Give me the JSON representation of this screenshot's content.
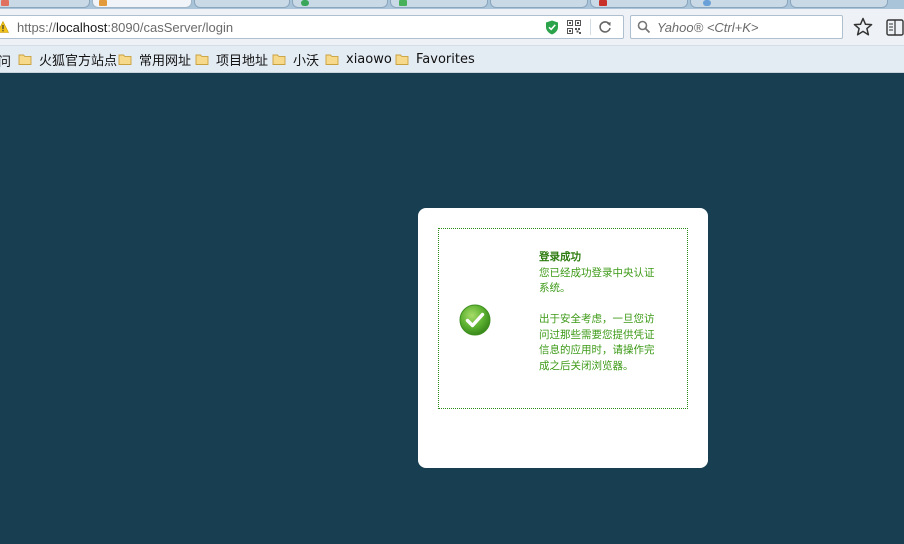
{
  "browser": {
    "url_prefix": "https://",
    "url_host": "localhost",
    "url_path": ":8090/casServer/login",
    "search_placeholder": "Yahoo® <Ctrl+K>"
  },
  "bookmarks": {
    "partial_label": "问",
    "items": [
      {
        "label": "火狐官方站点"
      },
      {
        "label": "常用网址"
      },
      {
        "label": "项目地址"
      },
      {
        "label": "小沃"
      },
      {
        "label": "xiaowo"
      },
      {
        "label": "Favorites"
      }
    ]
  },
  "login_result": {
    "title": "登录成功",
    "line1": "您已经成功登录中央认证",
    "line2": "系统。",
    "note1": "出于安全考虑，一旦您访",
    "note2": "问过那些需要您提供凭证",
    "note3": "信息的应用时，请操作完",
    "note4": "成之后关闭浏览器。"
  },
  "colors": {
    "page_bg": "#183f51",
    "success_text": "#3d9a17",
    "check_green": "#5cb130"
  }
}
